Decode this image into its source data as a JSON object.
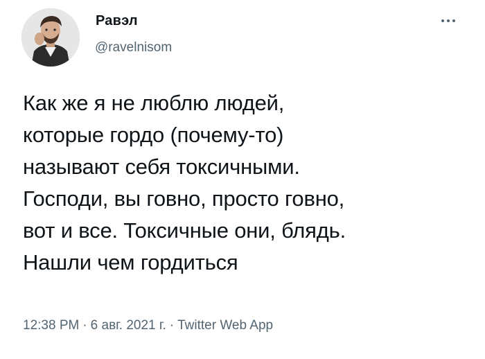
{
  "author": {
    "display_name": "Равэл",
    "handle": "@ravelnisom"
  },
  "tweet": {
    "lines": [
      "Как же я не люблю людей,",
      "которые гордо (почему-то)",
      "называют себя токсичными.",
      "Господи, вы говно, просто говно,",
      "вот и все. Токсичные они, блядь.",
      "Нашли чем гордиться"
    ]
  },
  "meta": {
    "time": "12:38 PM",
    "separator": "·",
    "date": "6 авг. 2021 г.",
    "source": "Twitter Web App"
  },
  "colors": {
    "text": "#0f1419",
    "secondary": "#536471",
    "background": "#ffffff"
  },
  "icons": {
    "more": "more-horizontal-icon"
  }
}
